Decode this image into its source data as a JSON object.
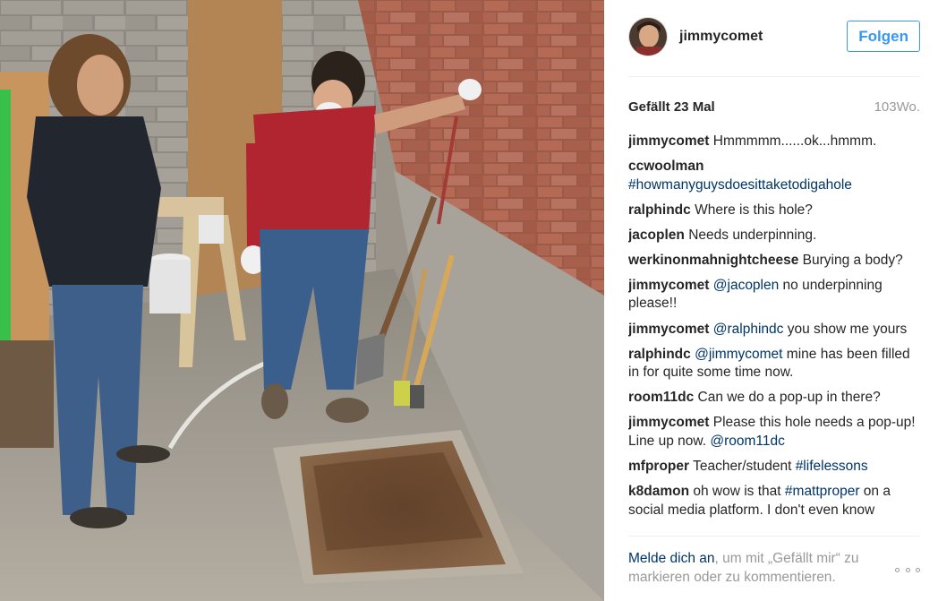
{
  "post": {
    "photo_alt": "",
    "header": {
      "username": "jimmycomet",
      "follow_label": "Folgen"
    },
    "likes_text": "Gefällt 23 Mal",
    "age_text": "103Wo.",
    "comments": [
      {
        "user": "jimmycomet",
        "parts": [
          {
            "t": "Hmmmmm......ok...hmmm."
          }
        ]
      },
      {
        "user": "ccwoolman",
        "parts": [
          {
            "t": "#howmanyguysdoesittaketodigahole",
            "tag": true
          }
        ]
      },
      {
        "user": "ralphindc",
        "parts": [
          {
            "t": "Where is this hole?"
          }
        ]
      },
      {
        "user": "jacoplen",
        "parts": [
          {
            "t": "Needs underpinning."
          }
        ]
      },
      {
        "user": "werkinonmahnightcheese",
        "parts": [
          {
            "t": "Burying a body?"
          }
        ]
      },
      {
        "user": "jimmycomet",
        "parts": [
          {
            "t": "@jacoplen",
            "tag": true
          },
          {
            "t": " no underpinning please!!"
          }
        ]
      },
      {
        "user": "jimmycomet",
        "parts": [
          {
            "t": "@ralphindc",
            "tag": true
          },
          {
            "t": " you show me yours"
          }
        ]
      },
      {
        "user": "ralphindc",
        "parts": [
          {
            "t": "@jimmycomet",
            "tag": true
          },
          {
            "t": " mine has been filled in for quite some time now."
          }
        ]
      },
      {
        "user": "room11dc",
        "parts": [
          {
            "t": "Can we do a pop-up in there?"
          }
        ]
      },
      {
        "user": "jimmycomet",
        "parts": [
          {
            "t": "Please this hole needs a pop-up! Line up now. "
          },
          {
            "t": "@room11dc",
            "tag": true
          }
        ]
      },
      {
        "user": "mfproper",
        "parts": [
          {
            "t": "Teacher/student "
          },
          {
            "t": "#lifelessons",
            "tag": true
          }
        ]
      },
      {
        "user": "k8damon",
        "parts": [
          {
            "t": "oh wow is that "
          },
          {
            "t": "#mattproper",
            "tag": true
          },
          {
            "t": " on a social media platform. I don't even know"
          }
        ]
      }
    ],
    "login_prompt": {
      "link": "Melde dich an",
      "rest": ", um mit „Gefällt mir“ zu markieren oder zu kommentieren."
    },
    "icons": {
      "avatar": "avatar",
      "more": "more-options-icon"
    },
    "colors": {
      "accent": "#3897f0",
      "link": "#003569",
      "muted": "#999999"
    }
  }
}
